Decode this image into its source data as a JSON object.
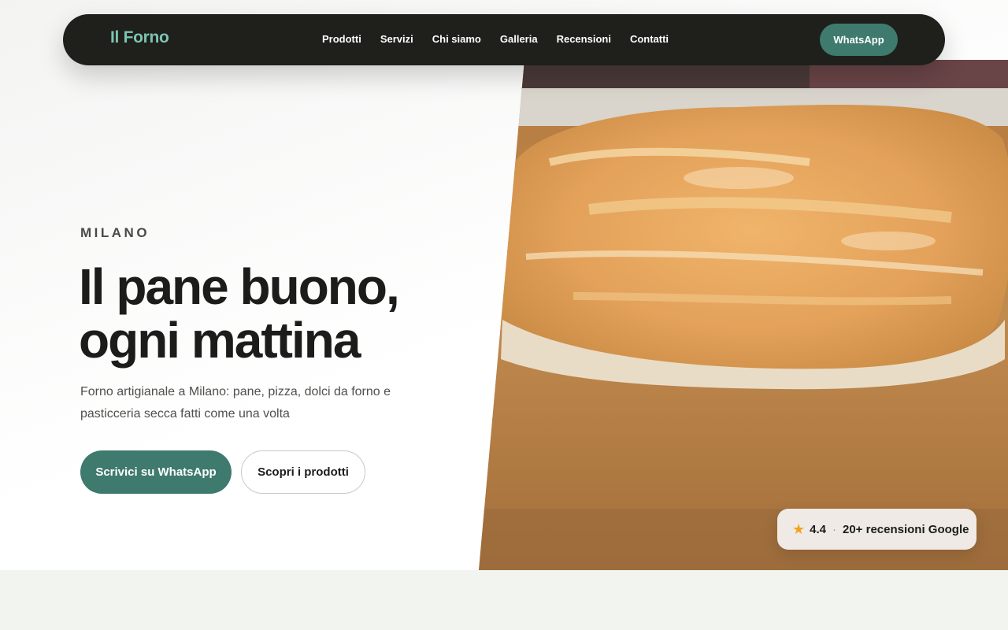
{
  "brand": {
    "name": "Il Forno"
  },
  "nav": {
    "items": [
      {
        "label": "Prodotti"
      },
      {
        "label": "Servizi"
      },
      {
        "label": "Chi siamo"
      },
      {
        "label": "Galleria"
      },
      {
        "label": "Recensioni"
      },
      {
        "label": "Contatti"
      }
    ],
    "cta_label": "WhatsApp"
  },
  "hero": {
    "eyebrow": "MILANO",
    "headline_line1": "Il pane buono,",
    "headline_line2": "ogni mattina",
    "subtitle": "Forno artigianale a Milano: pane, pizza, dolci da forno e pasticceria secca fatti come una volta",
    "primary_cta": "Scrivici su WhatsApp",
    "secondary_cta": "Scopri i prodotti",
    "image_icon": "bread-loaf-photo"
  },
  "rating": {
    "score": "4.4",
    "separator": "·",
    "reviews": "20+ recensioni Google",
    "star_icon": "star-icon",
    "star_color": "#f2a31c"
  },
  "colors": {
    "accent": "#3e7a6d",
    "brand_text": "#7cc4b2",
    "nav_background": "#1f1f1c"
  }
}
